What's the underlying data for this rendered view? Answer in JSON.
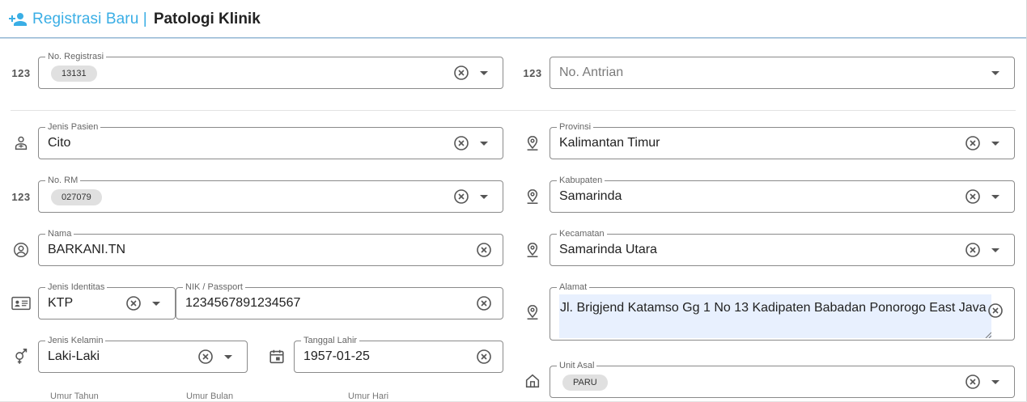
{
  "header": {
    "subtitle": "Registrasi Baru |",
    "title": "Patologi Klinik"
  },
  "icons": {
    "num": "123"
  },
  "fields": {
    "no_registrasi": {
      "label": "No. Registrasi",
      "chip": "13131"
    },
    "no_antrian": {
      "placeholder": "No. Antrian"
    },
    "jenis_pasien": {
      "label": "Jenis Pasien",
      "value": "Cito"
    },
    "no_rm": {
      "label": "No. RM",
      "chip": "027079"
    },
    "nama": {
      "label": "Nama",
      "value": "BARKANI.TN"
    },
    "jenis_identitas": {
      "label": "Jenis Identitas",
      "value": "KTP"
    },
    "nik": {
      "label": "NIK / Passport",
      "value": "1234567891234567"
    },
    "jenis_kelamin": {
      "label": "Jenis Kelamin",
      "value": "Laki-Laki"
    },
    "tanggal_lahir": {
      "label": "Tanggal Lahir",
      "value": "1957-01-25"
    },
    "provinsi": {
      "label": "Provinsi",
      "value": "Kalimantan Timur"
    },
    "kabupaten": {
      "label": "Kabupaten",
      "value": "Samarinda"
    },
    "kecamatan": {
      "label": "Kecamatan",
      "value": "Samarinda Utara"
    },
    "alamat": {
      "label": "Alamat",
      "value": "Jl. Brigjend Katamso Gg 1 No 13 Kadipaten Babadan Ponorogo East Java"
    },
    "unit_asal": {
      "label": "Unit Asal",
      "chip": "PARU"
    },
    "umur_tahun": {
      "label": "Umur Tahun"
    },
    "umur_bulan": {
      "label": "Umur Bulan"
    },
    "umur_hari": {
      "label": "Umur Hari"
    }
  },
  "colors": {
    "accent": "#3aaee5",
    "autofill": "#e8f0fe",
    "border": "#8a8a8a"
  }
}
